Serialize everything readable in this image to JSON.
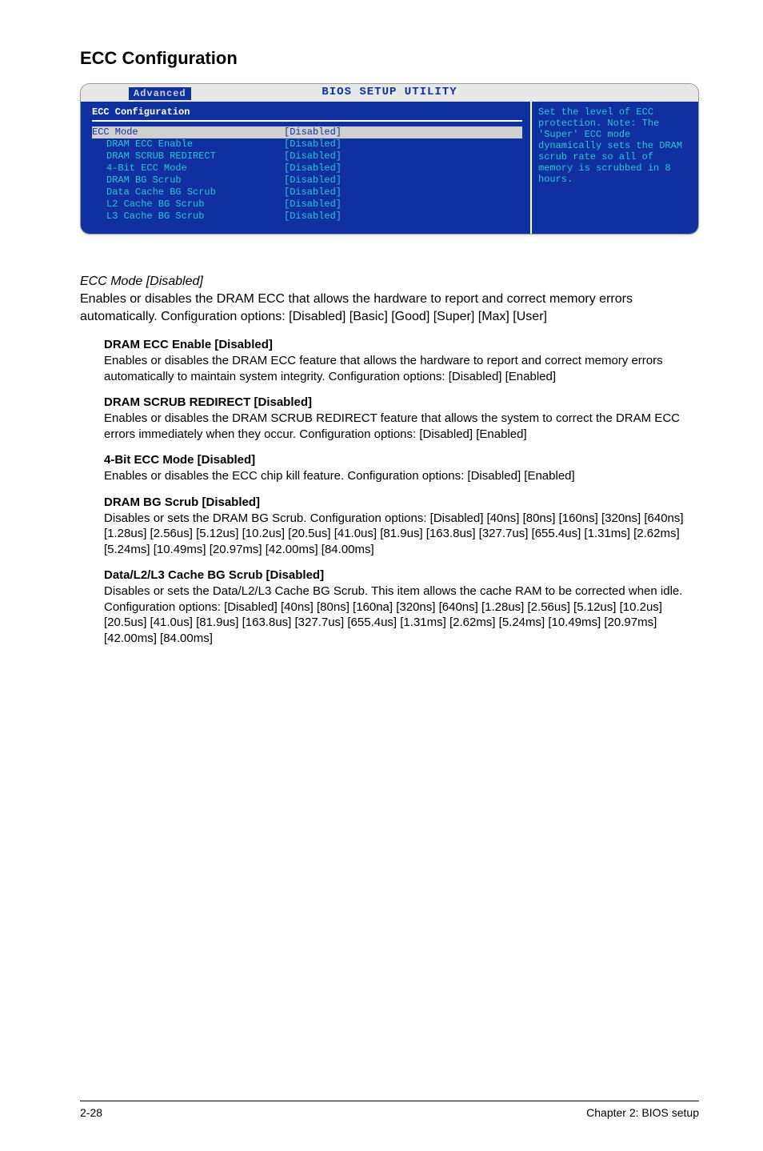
{
  "heading": "ECC Configuration",
  "bios": {
    "header": "BIOS SETUP UTILITY",
    "tab": "Advanced",
    "panel_title": "ECC Configuration",
    "selected": {
      "key": "ECC Mode",
      "val": "[Disabled]"
    },
    "rows": [
      {
        "key": "DRAM ECC Enable",
        "val": "[Disabled]"
      },
      {
        "key": "DRAM SCRUB REDIRECT",
        "val": "[Disabled]"
      },
      {
        "key": "4-Bit ECC Mode",
        "val": "[Disabled]"
      },
      {
        "key": "DRAM BG Scrub",
        "val": "[Disabled]"
      },
      {
        "key": "Data Cache BG Scrub",
        "val": "[Disabled]"
      },
      {
        "key": "L2 Cache BG Scrub",
        "val": "[Disabled]"
      },
      {
        "key": "L3 Cache BG Scrub",
        "val": "[Disabled]"
      }
    ],
    "help": "Set the level of ECC protection. Note: The 'Super' ECC mode dynamically sets the DRAM scrub rate so all of memory is scrubbed in 8 hours."
  },
  "sections": {
    "ecc_mode": {
      "title": "ECC Mode [Disabled]",
      "body": "Enables or disables the DRAM ECC that allows the hardware to report and correct memory errors automatically. Configuration options: [Disabled] [Basic] [Good] [Super] [Max] [User]"
    },
    "dram_ecc": {
      "title": "DRAM ECC Enable [Disabled]",
      "body": "Enables or disables the DRAM ECC feature that allows the hardware to report and correct memory errors automatically to maintain system integrity. Configuration options: [Disabled] [Enabled]"
    },
    "scrub_redirect": {
      "title": "DRAM SCRUB REDIRECT [Disabled]",
      "body": "Enables or disables the DRAM SCRUB REDIRECT feature that allows the system to correct the DRAM ECC errors immediately when they occur. Configuration options: [Disabled] [Enabled]"
    },
    "four_bit": {
      "title": "4-Bit ECC Mode [Disabled]",
      "body": "Enables or disables the ECC chip kill feature. Configuration options: [Disabled] [Enabled]"
    },
    "dram_bg": {
      "title": "DRAM BG Scrub [Disabled]",
      "body": "Disables or sets the DRAM BG Scrub. Configuration options: [Disabled] [40ns] [80ns] [160ns] [320ns] [640ns] [1.28us] [2.56us] [5.12us] [10.2us] [20.5us] [41.0us] [81.9us] [163.8us] [327.7us] [655.4us] [1.31ms] [2.62ms] [5.24ms] [10.49ms] [20.97ms] [42.00ms] [84.00ms]"
    },
    "data_l2_l3": {
      "title": "Data/L2/L3 Cache BG Scrub [Disabled]",
      "body": "Disables or sets the Data/L2/L3 Cache BG Scrub. This item allows the cache RAM to be corrected when idle. Configuration options: [Disabled] [40ns] [80ns] [160na] [320ns] [640ns] [1.28us] [2.56us] [5.12us] [10.2us] [20.5us] [41.0us] [81.9us] [163.8us] [327.7us] [655.4us] [1.31ms] [2.62ms] [5.24ms] [10.49ms] [20.97ms] [42.00ms] [84.00ms]"
    }
  },
  "footer": {
    "left": "2-28",
    "right": "Chapter 2: BIOS setup"
  }
}
